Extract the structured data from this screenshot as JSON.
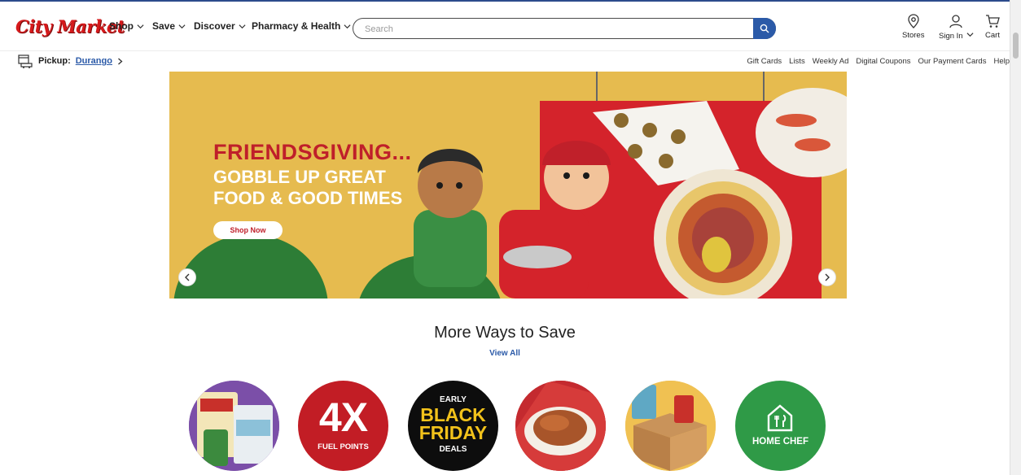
{
  "header": {
    "logo": "City Market",
    "nav": [
      "Shop",
      "Save",
      "Discover",
      "Pharmacy & Health"
    ],
    "search_placeholder": "Search",
    "stores": "Stores",
    "sign_in": "Sign In",
    "cart": "Cart"
  },
  "subbar": {
    "pickup_label": "Pickup:",
    "pickup_location": "Durango",
    "links": [
      "Gift Cards",
      "Lists",
      "Weekly Ad",
      "Digital Coupons",
      "Our Payment Cards",
      "Help"
    ]
  },
  "banner": {
    "headline": "FRIENDSGIVING...",
    "line1": "GOBBLE UP GREAT",
    "line2": "FOOD & GOOD TIMES",
    "cta": "Shop Now"
  },
  "section": {
    "title": "More Ways to Save",
    "view_all": "View All",
    "tiles": {
      "fuel_big": "4X",
      "fuel_small": "FUEL POINTS",
      "bf_early": "EARLY",
      "bf_black": "BLACK",
      "bf_friday": "FRIDAY",
      "bf_deals": "DEALS",
      "homechef": "HOME CHEF"
    }
  },
  "colors": {
    "brand_red": "#d6191b",
    "brand_blue": "#2b5aa8",
    "banner_yellow": "#e6bb4f",
    "banner_red": "#d4232b"
  }
}
